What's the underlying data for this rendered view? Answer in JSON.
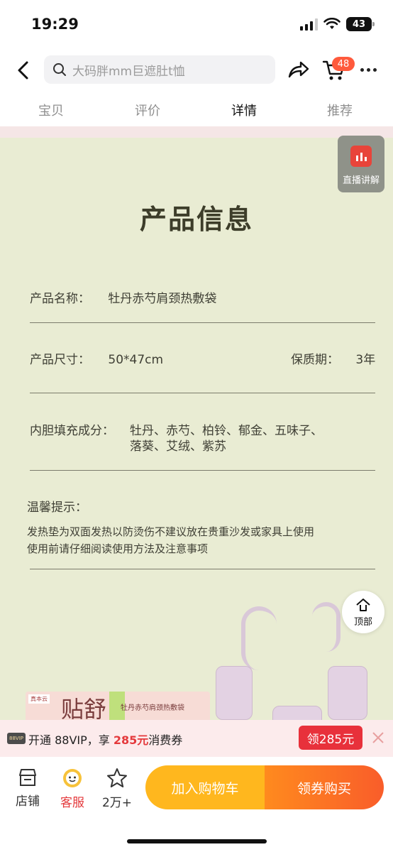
{
  "status_bar": {
    "time": "19:29",
    "battery": "43"
  },
  "search": {
    "placeholder": "大码胖mm巨遮肚t恤"
  },
  "cart": {
    "badge": "48"
  },
  "tabs": [
    {
      "label": "宝贝",
      "active": false
    },
    {
      "label": "评价",
      "active": false
    },
    {
      "label": "详情",
      "active": true
    },
    {
      "label": "推荐",
      "active": false
    }
  ],
  "live": {
    "label": "直播讲解"
  },
  "product_info": {
    "title": "产品信息",
    "name_label": "产品名称：",
    "name_value": "牡丹赤芍肩颈热敷袋",
    "size_label": "产品尺寸：",
    "size_value": "50*47cm",
    "shelf_label": "保质期：",
    "shelf_value": "3年",
    "filling_label": "内胆填充成分：",
    "filling_line1": "牡丹、赤芍、柏铃、郁金、五味子、",
    "filling_line2": "落葵、艾绒、紫苏",
    "tips_label": "温馨提示：",
    "tips_line1": "发热垫为双面发热以防烫伤不建议放在贵重沙发或家具上使用",
    "tips_line2": "使用前请仔细阅读使用方法及注意事项"
  },
  "product_box": {
    "big_text": "贴舒",
    "sub_text": "牡丹赤芍肩颈热敷袋"
  },
  "back_to_top": {
    "label": "顶部"
  },
  "vip_bar": {
    "tag": "88VIP",
    "text_before": "开通 88VIP，享 ",
    "amount": "285元",
    "text_after": "消费券",
    "button": "领285元"
  },
  "bottom_bar": {
    "shop": "店铺",
    "service": "客服",
    "favorites": "2万+",
    "add_to_cart": "加入购物车",
    "buy_with_coupon": "领券购买"
  },
  "colors": {
    "accent": "#ff5a3c",
    "content_bg": "#e9ecd3",
    "cart_button": "#ffb71e",
    "buy_button": "#f95d2a"
  }
}
